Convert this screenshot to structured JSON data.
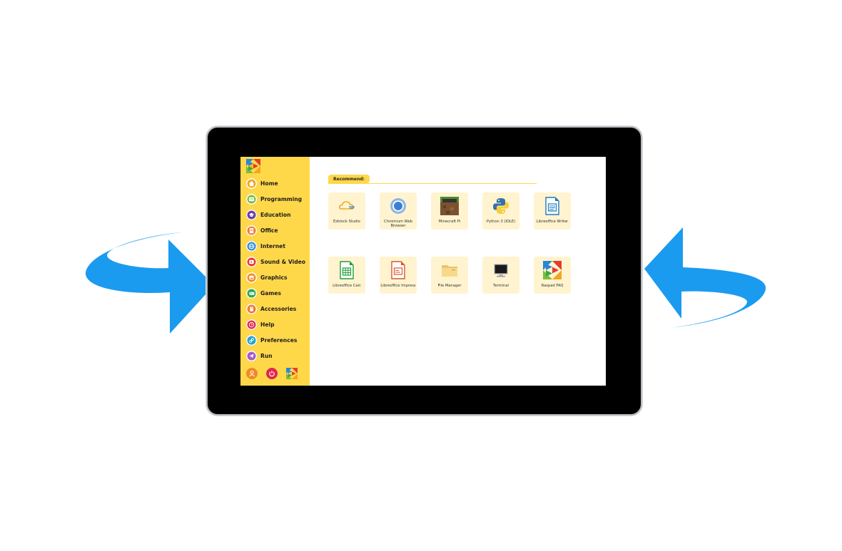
{
  "sidebar": {
    "items": [
      {
        "label": "Home",
        "icon": "home-icon",
        "color": "#f2a620"
      },
      {
        "label": "Programming",
        "icon": "programming-icon",
        "color": "#7cbd3a"
      },
      {
        "label": "Education",
        "icon": "education-icon",
        "color": "#6b3fa0"
      },
      {
        "label": "Office",
        "icon": "office-icon",
        "color": "#f07a2a"
      },
      {
        "label": "Internet",
        "icon": "globe-icon",
        "color": "#2a86d6"
      },
      {
        "label": "Sound & Video",
        "icon": "play-icon",
        "color": "#e63b2e"
      },
      {
        "label": "Graphics",
        "icon": "picture-icon",
        "color": "#f08a24"
      },
      {
        "label": "Games",
        "icon": "gamepad-icon",
        "color": "#3aa64a"
      },
      {
        "label": "Accessories",
        "icon": "accessories-icon",
        "color": "#f07a2a"
      },
      {
        "label": "Help",
        "icon": "help-icon",
        "color": "#e0264a"
      },
      {
        "label": "Preferences",
        "icon": "preferences-icon",
        "color": "#25a4c8"
      },
      {
        "label": "Run",
        "icon": "run-icon",
        "color": "#a65ac2"
      }
    ],
    "bottom": [
      {
        "icon": "user-icon",
        "color": "#f08a24"
      },
      {
        "icon": "power-icon",
        "color": "#e0264a"
      },
      {
        "icon": "raspad-logo-icon",
        "color": "#2a86d6"
      }
    ]
  },
  "recommend": {
    "title": "Recommend:"
  },
  "apps": [
    {
      "label": "Ezblock Studio",
      "icon": "ezblock-icon"
    },
    {
      "label": "Chromium Web Browser",
      "icon": "chromium-icon"
    },
    {
      "label": "Minecraft Pi",
      "icon": "minecraft-icon"
    },
    {
      "label": "Python 3 (IDLE)",
      "icon": "python-icon"
    },
    {
      "label": "Libreoffice Writer",
      "icon": "writer-icon"
    },
    {
      "label": "Libreoffice Calc",
      "icon": "calc-icon"
    },
    {
      "label": "Libreoffice Impress",
      "icon": "impress-icon"
    },
    {
      "label": "File Manager",
      "icon": "folder-icon"
    },
    {
      "label": "Terminal",
      "icon": "terminal-icon"
    },
    {
      "label": "Raspad FAQ",
      "icon": "raspad-faq-icon"
    }
  ],
  "colors": {
    "accent": "#ffd84a",
    "tile": "#fff4cf",
    "arrow": "#1a9bef"
  }
}
